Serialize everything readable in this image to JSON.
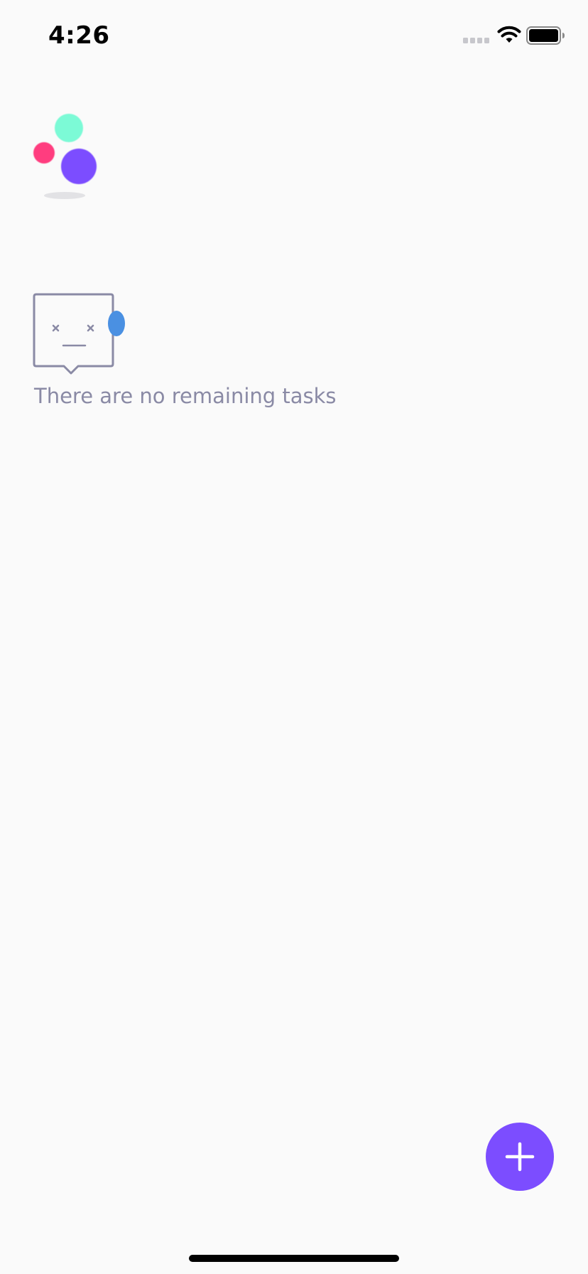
{
  "status_bar": {
    "time": "4:26"
  },
  "empty_state": {
    "message": "There are no remaining tasks"
  },
  "fab": {
    "label": "+"
  },
  "colors": {
    "background": "#fafafa",
    "accent": "#7c4dff",
    "logo_mint": "#7bfad6",
    "logo_pink": "#ff3d7f",
    "logo_purple": "#7c4dff",
    "empty_outline": "#8a8aa5",
    "empty_dot": "#4a90e2"
  }
}
